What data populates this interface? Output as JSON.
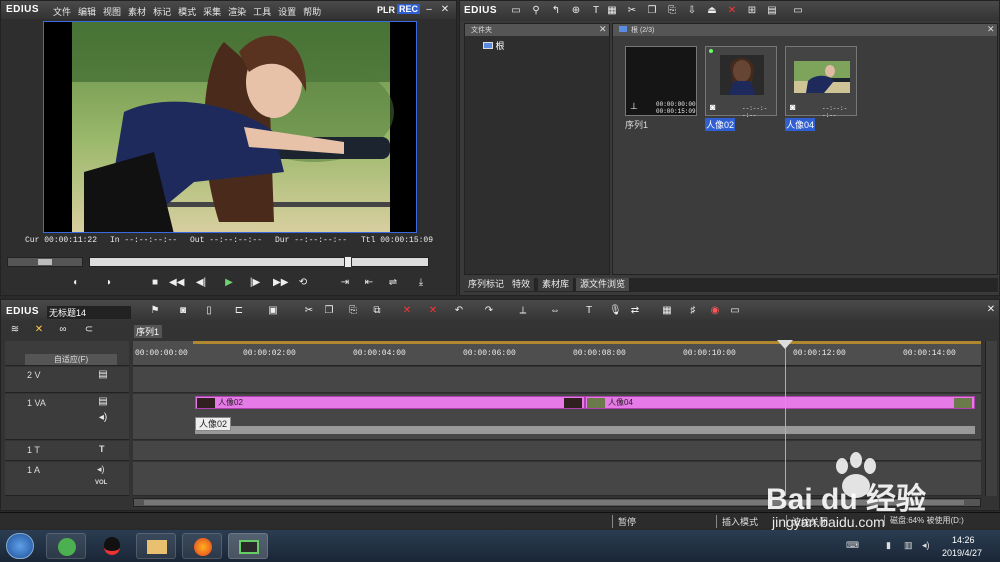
{
  "player": {
    "logo": "EDIUS",
    "menu": [
      "文件",
      "编辑",
      "视图",
      "素材",
      "标记",
      "模式",
      "采集",
      "渲染",
      "工具",
      "设置",
      "帮助"
    ],
    "plr": "PLR",
    "rec": "REC",
    "timecodes": {
      "cur_label": "Cur",
      "cur": "00:00:11:22",
      "in_label": "In",
      "in": "--:--:--:--",
      "out_label": "Out",
      "out": "--:--:--:--",
      "dur_label": "Dur",
      "dur": "--:--:--:--",
      "ttl_label": "Ttl",
      "ttl": "00:00:15:09"
    }
  },
  "bin": {
    "logo": "EDIUS",
    "folder_header": "文件夹",
    "folder_root": "根",
    "contents_header": "根 (2/3)",
    "clips": [
      {
        "name": "序列1",
        "tc1": "00:00:00:00",
        "tc2": "00:00:15:09"
      },
      {
        "name": "人像02",
        "tc1": "--:--:--:--"
      },
      {
        "name": "人像04",
        "tc1": "--:--:--:--"
      }
    ],
    "tabs": [
      "序列标记",
      "特效",
      "素材库",
      "源文件浏览"
    ]
  },
  "timeline": {
    "logo": "EDIUS",
    "project_name": "无标题14",
    "sequence_tab": "序列1",
    "mode_select": "自适应(F)",
    "ruler": [
      "00:00:00:00",
      "00:00:02:00",
      "00:00:04:00",
      "00:00:06:00",
      "00:00:08:00",
      "00:00:10:00",
      "00:00:12:00",
      "00:00:14:00"
    ],
    "tracks": [
      {
        "label": "2 V"
      },
      {
        "label": "1 VA"
      },
      {
        "label": "1 T"
      },
      {
        "label": "1 A",
        "vol": "VOL"
      }
    ],
    "clips": [
      {
        "name": "人像02"
      },
      {
        "name": "人像04"
      }
    ],
    "tooltip": "人像02"
  },
  "status": {
    "pause": "暂停",
    "insert_mode": "插入模式",
    "ripple": "波纹关闭",
    "disk": "磁盘:64% 被使用(D:)"
  },
  "taskbar": {
    "time": "14:26",
    "date": "2019/4/27"
  },
  "watermark": {
    "brand": "Bai du 经验",
    "url": "jingyan.baidu.com"
  }
}
